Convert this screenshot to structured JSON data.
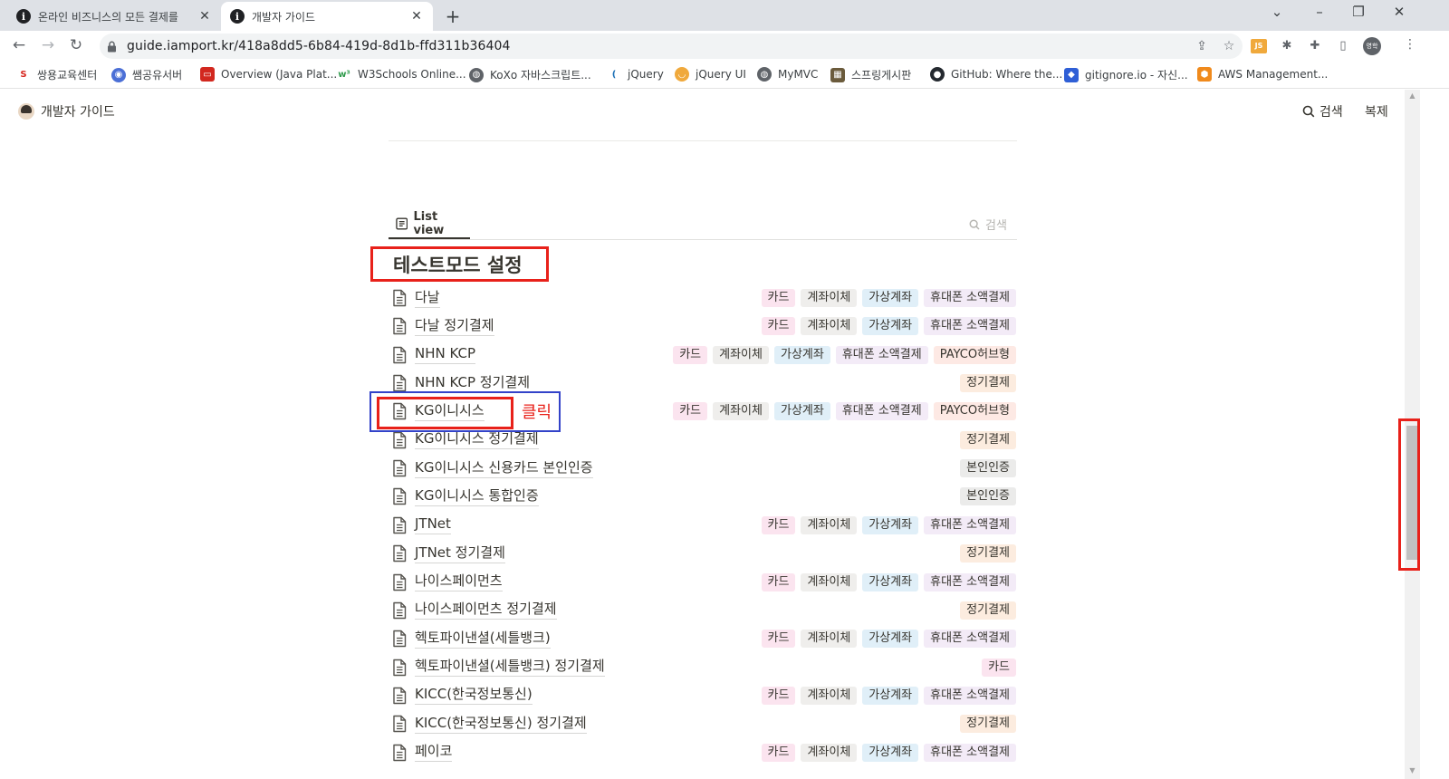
{
  "browser": {
    "tabs": [
      {
        "title": "온라인 비즈니스의 모든 결제를",
        "active": false
      },
      {
        "title": "개발자 가이드",
        "active": true
      }
    ],
    "url": "guide.iamport.kr/418a8dd5-6b84-419d-8d1b-ffd311b36404",
    "bookmarks": [
      {
        "label": "쌍용교육센터",
        "icon": "ssangyong-icon",
        "color": "#d7261e"
      },
      {
        "label": "쌤공유서버",
        "icon": "globe-icon",
        "color": "#4b6fd6"
      },
      {
        "label": "Overview (Java Plat...",
        "icon": "oracle-icon",
        "color": "#d2281f"
      },
      {
        "label": "W3Schools Online...",
        "icon": "w3schools-icon",
        "color": "#2f9b4c"
      },
      {
        "label": "KoXo 자바스크립트...",
        "icon": "koxo-icon",
        "color": "#5f6368"
      },
      {
        "label": "jQuery",
        "icon": "jquery-icon",
        "color": "#1a6fb6"
      },
      {
        "label": "jQuery UI",
        "icon": "jqueryui-icon",
        "color": "#f0a93c"
      },
      {
        "label": "MyMVC",
        "icon": "globe-icon",
        "color": "#5f6368"
      },
      {
        "label": "스프링게시판",
        "icon": "board-icon",
        "color": "#6b5b3c"
      },
      {
        "label": "GitHub: Where the...",
        "icon": "github-icon",
        "color": "#24292f"
      },
      {
        "label": "gitignore.io - 자신...",
        "icon": "gitignore-icon",
        "color": "#2f5fd6"
      },
      {
        "label": "AWS Management...",
        "icon": "aws-icon",
        "color": "#f08a1c"
      }
    ]
  },
  "header": {
    "site_title": "개발자 가이드",
    "search_label": "검색",
    "duplicate_label": "복제"
  },
  "view": {
    "tab_label": "List view",
    "search_placeholder": "검색"
  },
  "group_title": "테스트모드 설정",
  "annotation": {
    "click_label": "클릭"
  },
  "tag_colors": {
    "카드": "#fbe4ef",
    "계좌이체": "#efeeec",
    "가상계좌": "#e0eff8",
    "휴대폰 소액결제": "#f3ebf7",
    "PAYCO허브형": "#fde9e4",
    "정기결제": "#fcecdf",
    "본인인증": "#ebebea"
  },
  "rows": [
    {
      "name": "다날",
      "tags": [
        "카드",
        "계좌이체",
        "가상계좌",
        "휴대폰 소액결제"
      ]
    },
    {
      "name": "다날 정기결제",
      "tags": [
        "카드",
        "계좌이체",
        "가상계좌",
        "휴대폰 소액결제"
      ]
    },
    {
      "name": "NHN KCP",
      "tags": [
        "카드",
        "계좌이체",
        "가상계좌",
        "휴대폰 소액결제",
        "PAYCO허브형"
      ]
    },
    {
      "name": "NHN KCP 정기결제",
      "tags": [
        "정기결제"
      ]
    },
    {
      "name": "KG이니시스",
      "tags": [
        "카드",
        "계좌이체",
        "가상계좌",
        "휴대폰 소액결제",
        "PAYCO허브형"
      ]
    },
    {
      "name": "KG이니시스 정기결제",
      "tags": [
        "정기결제"
      ]
    },
    {
      "name": "KG이니시스 신용카드 본인인증",
      "tags": [
        "본인인증"
      ]
    },
    {
      "name": "KG이니시스 통합인증",
      "tags": [
        "본인인증"
      ]
    },
    {
      "name": "JTNet",
      "tags": [
        "카드",
        "계좌이체",
        "가상계좌",
        "휴대폰 소액결제"
      ]
    },
    {
      "name": "JTNet 정기결제",
      "tags": [
        "정기결제"
      ]
    },
    {
      "name": "나이스페이먼츠",
      "tags": [
        "카드",
        "계좌이체",
        "가상계좌",
        "휴대폰 소액결제"
      ]
    },
    {
      "name": "나이스페이먼츠 정기결제",
      "tags": [
        "정기결제"
      ]
    },
    {
      "name": "헥토파이낸셜(세틀뱅크)",
      "tags": [
        "카드",
        "계좌이체",
        "가상계좌",
        "휴대폰 소액결제"
      ]
    },
    {
      "name": "헥토파이낸셜(세틀뱅크) 정기결제",
      "tags": [
        "카드"
      ]
    },
    {
      "name": "KICC(한국정보통신)",
      "tags": [
        "카드",
        "계좌이체",
        "가상계좌",
        "휴대폰 소액결제"
      ]
    },
    {
      "name": "KICC(한국정보통신) 정기결제",
      "tags": [
        "정기결제"
      ]
    },
    {
      "name": "페이코",
      "tags": [
        "카드",
        "계좌이체",
        "가상계좌",
        "휴대폰 소액결제"
      ]
    }
  ]
}
